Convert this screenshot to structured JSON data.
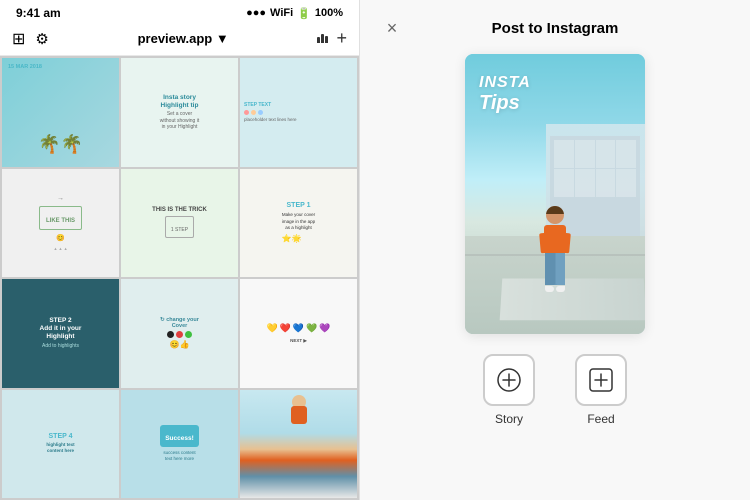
{
  "phone": {
    "status_bar": {
      "time": "9:41 am",
      "signal": "●●●",
      "wifi": "WiFi",
      "battery": "100%"
    },
    "nav": {
      "title": "preview.app ▼",
      "left_icons": [
        "calendar-icon",
        "gear-icon"
      ],
      "right_icons": [
        "chart-icon",
        "add-icon"
      ]
    },
    "grid_cells": [
      {
        "id": 1,
        "label": "15 MAR 2018",
        "type": "date-teal",
        "bg": "#7ecfd8"
      },
      {
        "id": 2,
        "label": "Insta story\nHighlight tip",
        "type": "tip-card",
        "bg": "#e8f4f0"
      },
      {
        "id": 3,
        "label": "",
        "type": "text-content",
        "bg": "#d4ecf0"
      },
      {
        "id": 4,
        "label": "LIKE THIS",
        "type": "outline-green",
        "bg": "#f0f0f0"
      },
      {
        "id": 5,
        "label": "THIS IS THE TRICK",
        "type": "dark-text",
        "bg": "#e8f5e8"
      },
      {
        "id": 6,
        "label": "STEP 1",
        "type": "step",
        "bg": "#f5f5f0"
      },
      {
        "id": 7,
        "label": "STEP 2\nAdd it in your\nHighlight",
        "type": "dark-bg",
        "bg": "#2a5f6b"
      },
      {
        "id": 8,
        "label": "Change your Cover",
        "type": "light-teal",
        "bg": "#e0eeee"
      },
      {
        "id": 9,
        "label": "",
        "type": "emojis",
        "bg": "#f8f8f8"
      },
      {
        "id": 10,
        "label": "STEP 4",
        "type": "step-teal",
        "bg": "#d0e8ec"
      },
      {
        "id": 11,
        "label": "Success!",
        "type": "success",
        "bg": "#b0d4dc"
      },
      {
        "id": 12,
        "label": "",
        "type": "person",
        "bg": "#e8f2f0"
      }
    ]
  },
  "post_panel": {
    "title": "Post to Instagram",
    "close_label": "×",
    "preview_text_line1": "INSTA",
    "preview_text_line2": "Tips",
    "options": [
      {
        "id": "story",
        "label": "Story",
        "icon": "⊕"
      },
      {
        "id": "feed",
        "label": "Feed",
        "icon": "⊞"
      }
    ]
  },
  "icons": {
    "close": "×",
    "calendar": "▦",
    "gear": "⚙",
    "chart": "📊",
    "add": "+",
    "story_icon": "⊕",
    "feed_icon": "⊞"
  }
}
